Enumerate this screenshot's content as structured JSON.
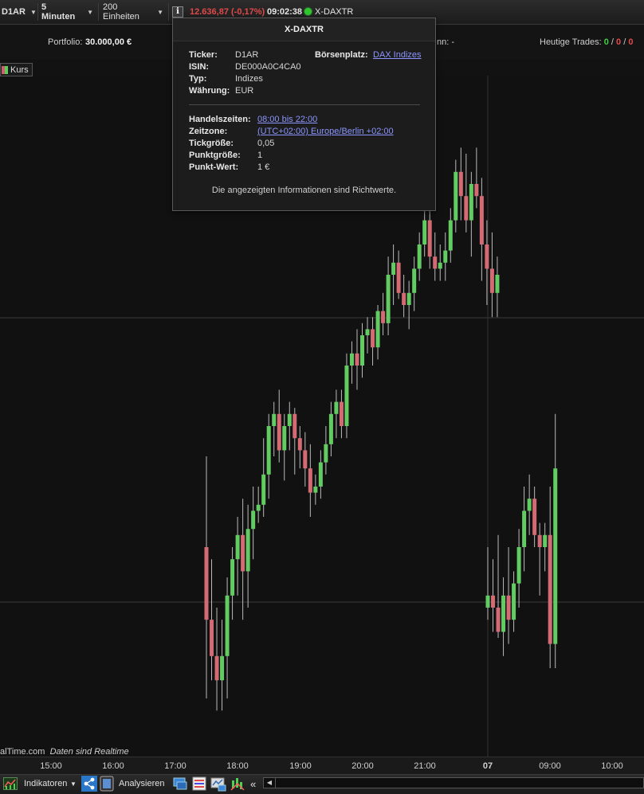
{
  "toolbar": {
    "ticker": "D1AR",
    "interval": "5 Minuten",
    "units": "200 Einheiten",
    "info_icon": "i",
    "price": "12.636,87",
    "change": "(-0,17%)",
    "time": "09:02:38",
    "ticker_name": "X-DAXTR",
    "status_color": "#2fc62f"
  },
  "portfolio": {
    "label": "Portfolio:",
    "value": "30.000,00 €",
    "gewinn_label": "nn:",
    "gewinn_value": "-",
    "trades_label": "Heutige Trades:",
    "trades_green": "0",
    "trades_sep1": "/",
    "trades_red": "0",
    "trades_sep2": "/",
    "trades_other": "0"
  },
  "legend": {
    "label": "Kurs"
  },
  "popup": {
    "title": "X-DAXTR",
    "ticker_label": "Ticker:",
    "ticker_value": "D1AR",
    "isin_label": "ISIN:",
    "isin_value": "DE000A0C4CA0",
    "typ_label": "Typ:",
    "typ_value": "Indizes",
    "waehrung_label": "Währung:",
    "waehrung_value": "EUR",
    "boerse_label": "Börsenplatz:",
    "boerse_value": "DAX Indizes",
    "handelszeiten_label": "Handelszeiten:",
    "handelszeiten_value": "08:00 bis 22:00",
    "zeitzone_label": "Zeitzone:",
    "zeitzone_value": "(UTC+02:00) Europe/Berlin +02:00",
    "tick_label": "Tickgröße:",
    "tick_value": "0,05",
    "punkt_label": "Punktgröße:",
    "punkt_value": "1",
    "punktwert_label": "Punkt-Wert:",
    "punktwert_value": "1 €",
    "note": "Die angezeigten Informationen sind Richtwerte."
  },
  "footnote": {
    "source": "alTime.com",
    "realtime": "Daten sind Realtime"
  },
  "xaxis": {
    "labels": [
      "15:00",
      "16:00",
      "17:00",
      "18:00",
      "19:00",
      "20:00",
      "21:00",
      "07",
      "09:00",
      "10:00"
    ]
  },
  "bottombar": {
    "indikatoren": "Indikatoren",
    "analysieren": "Analysieren",
    "scroll_left": "«"
  },
  "chart_data": {
    "type": "candlestick",
    "up_color": "#62cc62",
    "down_color": "#d46a74",
    "grid": true,
    "candles": [
      {
        "t": "17:35",
        "o": 70,
        "h": 55,
        "l": 95,
        "c": 82
      },
      {
        "t": "17:40",
        "o": 82,
        "h": 72,
        "l": 92,
        "c": 88
      },
      {
        "t": "17:45",
        "o": 88,
        "h": 80,
        "l": 97,
        "c": 92
      },
      {
        "t": "17:50",
        "o": 92,
        "h": 82,
        "l": 97,
        "c": 88
      },
      {
        "t": "17:55",
        "o": 88,
        "h": 75,
        "l": 95,
        "c": 78
      },
      {
        "t": "18:00",
        "o": 78,
        "h": 70,
        "l": 82,
        "c": 72
      },
      {
        "t": "18:05",
        "o": 72,
        "h": 65,
        "l": 78,
        "c": 68
      },
      {
        "t": "18:10",
        "o": 68,
        "h": 62,
        "l": 82,
        "c": 74
      },
      {
        "t": "18:15",
        "o": 74,
        "h": 63,
        "l": 80,
        "c": 67
      },
      {
        "t": "18:20",
        "o": 67,
        "h": 60,
        "l": 72,
        "c": 64
      },
      {
        "t": "18:25",
        "o": 64,
        "h": 60,
        "l": 66,
        "c": 63
      },
      {
        "t": "18:30",
        "o": 63,
        "h": 52,
        "l": 65,
        "c": 58
      },
      {
        "t": "18:35",
        "o": 58,
        "h": 48,
        "l": 62,
        "c": 50
      },
      {
        "t": "18:40",
        "o": 50,
        "h": 46,
        "l": 55,
        "c": 48
      },
      {
        "t": "18:45",
        "o": 48,
        "h": 44,
        "l": 56,
        "c": 54
      },
      {
        "t": "18:50",
        "o": 54,
        "h": 48,
        "l": 59,
        "c": 50
      },
      {
        "t": "18:55",
        "o": 50,
        "h": 46,
        "l": 54,
        "c": 48
      },
      {
        "t": "19:00",
        "o": 48,
        "h": 47,
        "l": 58,
        "c": 52
      },
      {
        "t": "19:05",
        "o": 52,
        "h": 50,
        "l": 57,
        "c": 54
      },
      {
        "t": "19:10",
        "o": 54,
        "h": 51,
        "l": 60,
        "c": 57
      },
      {
        "t": "19:15",
        "o": 57,
        "h": 53,
        "l": 65,
        "c": 61
      },
      {
        "t": "19:20",
        "o": 61,
        "h": 58,
        "l": 63,
        "c": 60
      },
      {
        "t": "19:25",
        "o": 60,
        "h": 54,
        "l": 62,
        "c": 56
      },
      {
        "t": "19:30",
        "o": 56,
        "h": 50,
        "l": 58,
        "c": 53
      },
      {
        "t": "19:35",
        "o": 53,
        "h": 46,
        "l": 55,
        "c": 48
      },
      {
        "t": "19:40",
        "o": 48,
        "h": 44,
        "l": 52,
        "c": 46
      },
      {
        "t": "19:45",
        "o": 46,
        "h": 44,
        "l": 52,
        "c": 50
      },
      {
        "t": "19:50",
        "o": 50,
        "h": 38,
        "l": 52,
        "c": 40
      },
      {
        "t": "19:55",
        "o": 40,
        "h": 36,
        "l": 43,
        "c": 38
      },
      {
        "t": "20:00",
        "o": 38,
        "h": 34,
        "l": 44,
        "c": 40
      },
      {
        "t": "20:05",
        "o": 40,
        "h": 33,
        "l": 42,
        "c": 35
      },
      {
        "t": "20:10",
        "o": 35,
        "h": 32,
        "l": 38,
        "c": 34
      },
      {
        "t": "20:15",
        "o": 34,
        "h": 32,
        "l": 40,
        "c": 37
      },
      {
        "t": "20:20",
        "o": 37,
        "h": 30,
        "l": 39,
        "c": 31
      },
      {
        "t": "20:25",
        "o": 31,
        "h": 28,
        "l": 35,
        "c": 33
      },
      {
        "t": "20:30",
        "o": 33,
        "h": 22,
        "l": 35,
        "c": 25
      },
      {
        "t": "20:35",
        "o": 25,
        "h": 20,
        "l": 30,
        "c": 23
      },
      {
        "t": "20:40",
        "o": 23,
        "h": 21,
        "l": 29,
        "c": 28
      },
      {
        "t": "20:45",
        "o": 28,
        "h": 25,
        "l": 32,
        "c": 30
      },
      {
        "t": "20:50",
        "o": 30,
        "h": 26,
        "l": 34,
        "c": 28
      },
      {
        "t": "20:55",
        "o": 28,
        "h": 22,
        "l": 31,
        "c": 24
      },
      {
        "t": "21:00",
        "o": 24,
        "h": 18,
        "l": 26,
        "c": 20
      },
      {
        "t": "21:05",
        "o": 20,
        "h": 12,
        "l": 22,
        "c": 16
      },
      {
        "t": "21:10",
        "o": 16,
        "h": 10,
        "l": 24,
        "c": 22
      },
      {
        "t": "21:15",
        "o": 22,
        "h": 18,
        "l": 26,
        "c": 24
      },
      {
        "t": "21:20",
        "o": 24,
        "h": 20,
        "l": 26,
        "c": 23
      },
      {
        "t": "21:25",
        "o": 23,
        "h": 18,
        "l": 26,
        "c": 21
      },
      {
        "t": "21:30",
        "o": 21,
        "h": 14,
        "l": 23,
        "c": 16
      },
      {
        "t": "21:35",
        "o": 16,
        "h": 6,
        "l": 18,
        "c": 8
      },
      {
        "t": "21:40",
        "o": 8,
        "h": 4,
        "l": 16,
        "c": 12
      },
      {
        "t": "21:45",
        "o": 12,
        "h": 5,
        "l": 18,
        "c": 16
      },
      {
        "t": "21:50",
        "o": 16,
        "h": 8,
        "l": 22,
        "c": 10
      },
      {
        "t": "21:55",
        "o": 10,
        "h": 4,
        "l": 14,
        "c": 12
      },
      {
        "t": "22:00",
        "o": 12,
        "h": 9,
        "l": 26,
        "c": 20
      },
      {
        "t": "22:05",
        "o": 20,
        "h": 16,
        "l": 30,
        "c": 24
      },
      {
        "t": "22:10",
        "o": 24,
        "h": 18,
        "l": 32,
        "c": 28
      },
      {
        "t": "22:15",
        "o": 28,
        "h": 22,
        "l": 32,
        "c": 25
      },
      {
        "t": "08:00",
        "o": 80,
        "h": 70,
        "l": 82,
        "c": 78
      },
      {
        "t": "08:05",
        "o": 78,
        "h": 72,
        "l": 84,
        "c": 80
      },
      {
        "t": "08:10",
        "o": 80,
        "h": 68,
        "l": 85,
        "c": 84
      },
      {
        "t": "08:15",
        "o": 84,
        "h": 75,
        "l": 88,
        "c": 78
      },
      {
        "t": "08:20",
        "o": 78,
        "h": 70,
        "l": 86,
        "c": 82
      },
      {
        "t": "08:25",
        "o": 82,
        "h": 74,
        "l": 84,
        "c": 76
      },
      {
        "t": "08:30",
        "o": 76,
        "h": 67,
        "l": 80,
        "c": 70
      },
      {
        "t": "08:35",
        "o": 70,
        "h": 60,
        "l": 74,
        "c": 64
      },
      {
        "t": "08:40",
        "o": 64,
        "h": 58,
        "l": 68,
        "c": 62
      },
      {
        "t": "08:45",
        "o": 62,
        "h": 60,
        "l": 70,
        "c": 68
      },
      {
        "t": "08:50",
        "o": 68,
        "h": 66,
        "l": 78,
        "c": 70
      },
      {
        "t": "08:55",
        "o": 70,
        "h": 66,
        "l": 74,
        "c": 68
      },
      {
        "t": "09:00",
        "o": 68,
        "h": 60,
        "l": 90,
        "c": 86
      },
      {
        "t": "09:05",
        "o": 86,
        "h": 48,
        "l": 90,
        "c": 57
      }
    ]
  }
}
